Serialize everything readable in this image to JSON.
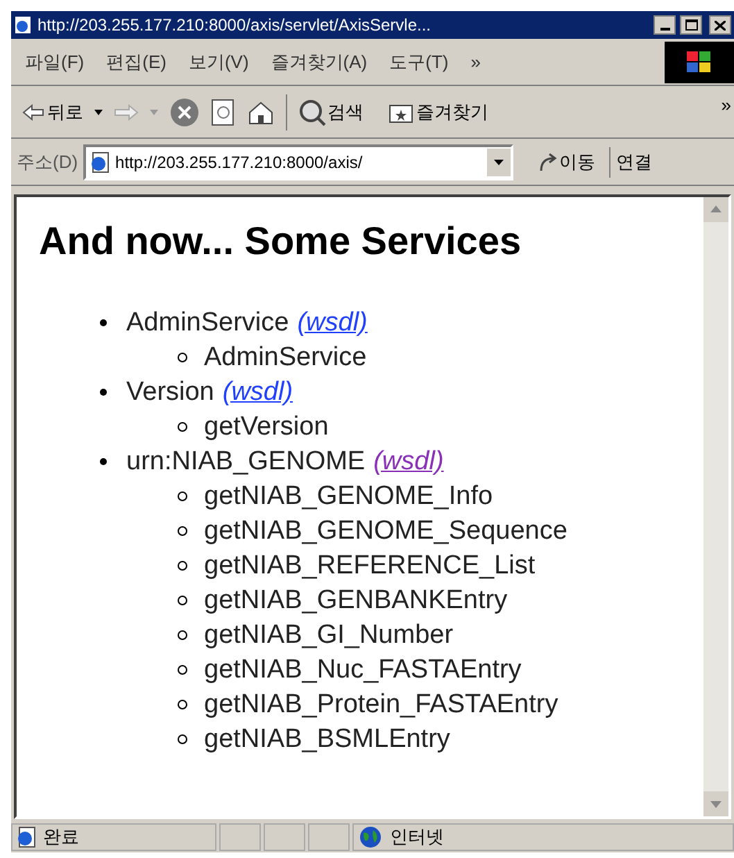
{
  "window": {
    "title": "http://203.255.177.210:8000/axis/servlet/AxisServle..."
  },
  "menu": [
    "파일(F)",
    "편집(E)",
    "보기(V)",
    "즐겨찾기(A)",
    "도구(T)",
    "»"
  ],
  "toolbar": {
    "back": "뒤로",
    "search": "검색",
    "favorites": "즐겨찾기",
    "more": "»"
  },
  "address_bar": {
    "label": "주소(D)",
    "value": "http://203.255.177.210:8000/axis/",
    "go": "이동",
    "links": "연결"
  },
  "page": {
    "heading": "And now... Some Services",
    "services": [
      {
        "name": "AdminService",
        "link": "(wsdl)",
        "visited": false,
        "methods": [
          "AdminService"
        ]
      },
      {
        "name": "Version",
        "link": "(wsdl)",
        "visited": false,
        "methods": [
          "getVersion"
        ]
      },
      {
        "name": "urn:NIAB_GENOME",
        "link": "(wsdl)",
        "visited": true,
        "methods": [
          "getNIAB_GENOME_Info",
          "getNIAB_GENOME_Sequence",
          "getNIAB_REFERENCE_List",
          "getNIAB_GENBANKEntry",
          "getNIAB_GI_Number",
          "getNIAB_Nuc_FASTAEntry",
          "getNIAB_Protein_FASTAEntry",
          "getNIAB_BSMLEntry"
        ]
      }
    ]
  },
  "status_bar": {
    "status": "완료",
    "zone": "인터넷"
  }
}
